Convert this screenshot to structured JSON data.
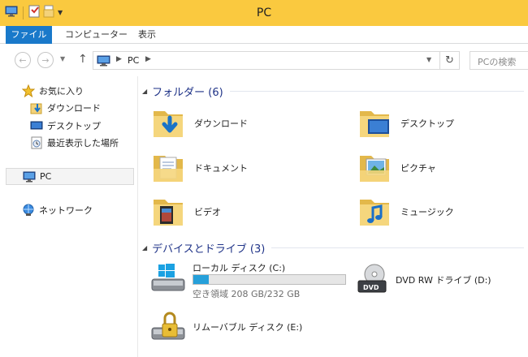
{
  "window": {
    "title": "PC"
  },
  "ribbon": {
    "tabs": [
      {
        "label": "ファイル"
      },
      {
        "label": "コンピューター"
      },
      {
        "label": "表示"
      }
    ]
  },
  "address": {
    "location": "PC",
    "search_placeholder": "PCの検索"
  },
  "navpane": {
    "favorites": "お気に入り",
    "favorites_items": [
      {
        "label": "ダウンロード"
      },
      {
        "label": "デスクトップ"
      },
      {
        "label": "最近表示した場所"
      }
    ],
    "this_pc": "PC",
    "network": "ネットワーク"
  },
  "folders": {
    "header": "フォルダー (6)",
    "items": [
      {
        "label": "ダウンロード",
        "icon": "downloads-folder-icon"
      },
      {
        "label": "デスクトップ",
        "icon": "desktop-folder-icon"
      },
      {
        "label": "ドキュメント",
        "icon": "documents-folder-icon"
      },
      {
        "label": "ピクチャ",
        "icon": "pictures-folder-icon"
      },
      {
        "label": "ビデオ",
        "icon": "videos-folder-icon"
      },
      {
        "label": "ミュージック",
        "icon": "music-folder-icon"
      }
    ]
  },
  "devices": {
    "header": "デバイスとドライブ (3)",
    "drives": [
      {
        "label": "ローカル ディスク (C:)",
        "free_text": "空き領域 208 GB/232 GB",
        "used_fraction": 0.104,
        "bar_color": "#26a0da"
      },
      {
        "label": "DVD RW ドライブ (D:)"
      },
      {
        "label": "リムーバブル ディスク (E:)"
      }
    ]
  },
  "colors": {
    "titlebar": "#fac93f",
    "file_tab": "#1979ca",
    "group_header": "#1e3287"
  }
}
